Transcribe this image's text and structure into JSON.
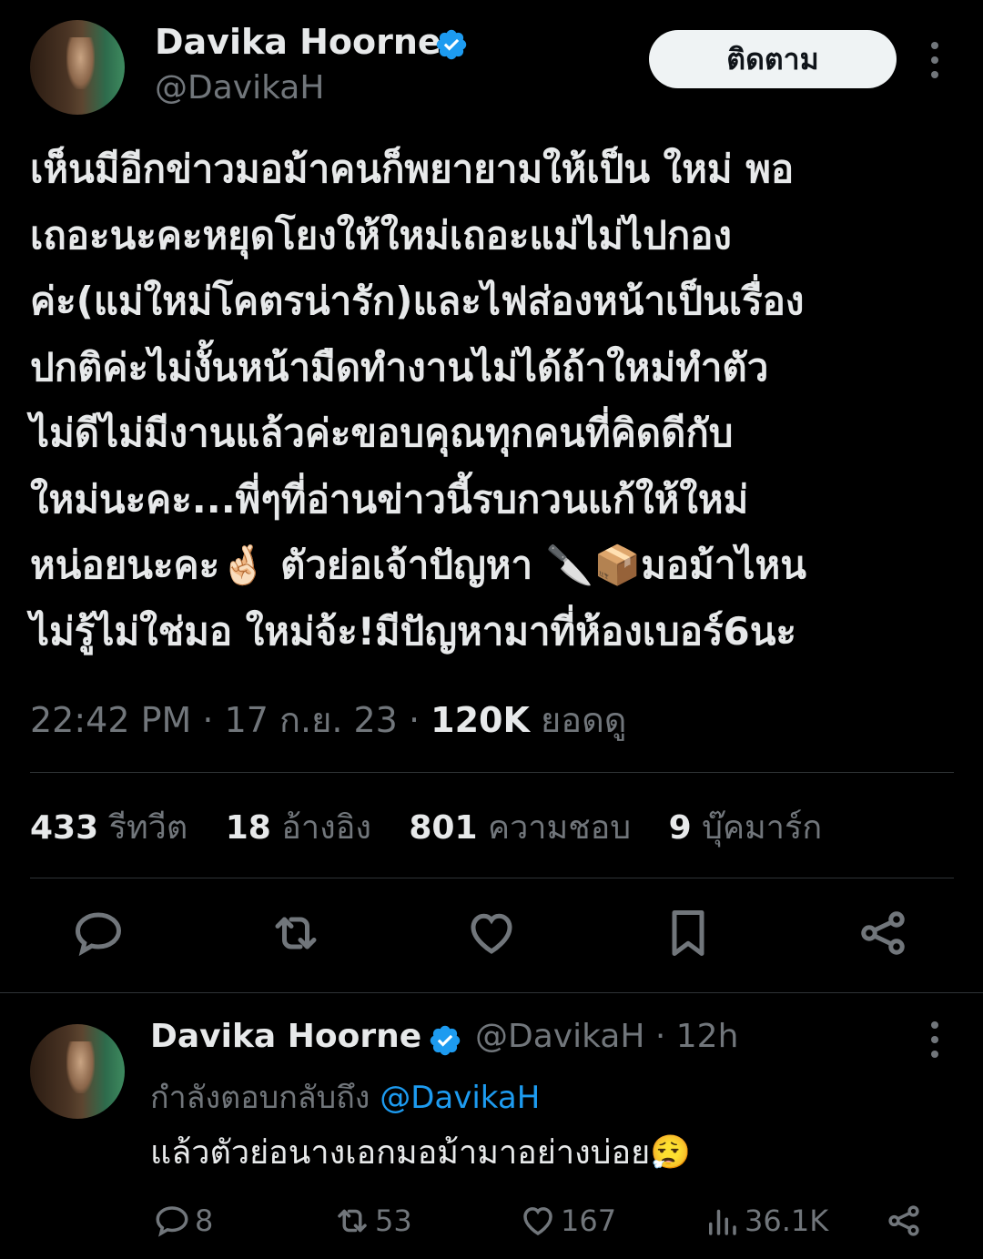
{
  "main_tweet": {
    "author_name": "Davika Hoorne",
    "handle": "@DavikaH",
    "follow_label": "ติดตาม",
    "text": "เห็นมีอีกข่าวมอม้าคนก็พยายามให้เป็น ใหม่ พอ\nเถอะนะคะหยุดโยงให้ใหม่เถอะแม่ไม่ไปกอง\nค่ะ(แม่ใหม่โคตรน่ารัก)และไฟส่องหน้าเป็นเรื่อง\nปกติค่ะไม่งั้นหน้ามืดทำงานไม่ได้ถ้าใหม่ทำตัว\nไม่ดีไม่มีงานแล้วค่ะขอบคุณทุกคนที่คิดดีกับ\nใหม่นะคะ...พี่ๆที่อ่านข่าวนี้รบกวนแก้ให้ใหม่\nหน่อยนะคะ🤞🏻 ตัวย่อเจ้าปัญหา 🔪📦มอม้าไหน\nไม่รู้ไม่ใช่มอ ใหม่จ้ะ!มีปัญหามาที่ห้องเบอร์6นะ",
    "time": "22:42 PM",
    "date": "17 ก.ย. 23",
    "views": "120K",
    "views_label": "ยอดดู",
    "stats": {
      "retweets": "433",
      "retweets_label": "รีทวีต",
      "quotes": "18",
      "quotes_label": "อ้างอิง",
      "likes": "801",
      "likes_label": "ความชอบ",
      "bookmarks": "9",
      "bookmarks_label": "บุ๊คมาร์ก"
    },
    "action_icons": [
      "reply-icon",
      "retweet-icon",
      "like-icon",
      "bookmark-icon",
      "share-icon"
    ]
  },
  "reply": {
    "author_name": "Davika Hoorne",
    "handle": "@DavikaH",
    "age": "12h",
    "replying_label": "กำลังตอบกลับถึง",
    "replying_to": "@DavikaH",
    "text": "แล้วตัวย่อนางเอกมอม้ามาอย่างบ่อย😮‍💨",
    "counts": {
      "replies": "8",
      "retweets": "53",
      "likes": "167",
      "views": "36.1K"
    }
  },
  "colors": {
    "background": "#000000",
    "text_primary": "#e7e9ea",
    "text_secondary": "#71767b",
    "accent": "#1d9bf0",
    "divider": "#2f3336"
  }
}
